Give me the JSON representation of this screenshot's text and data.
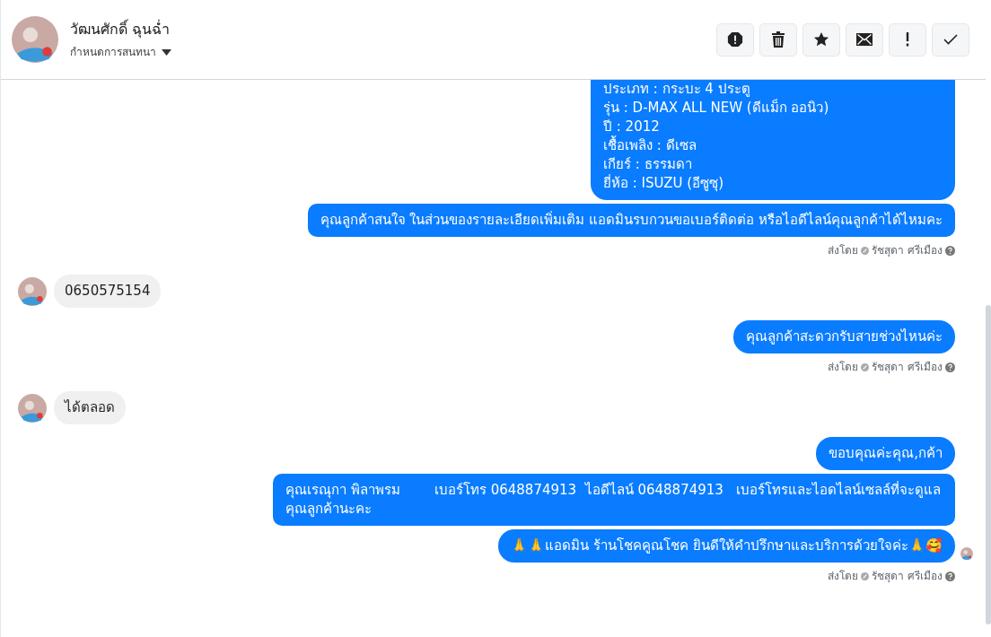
{
  "header": {
    "name": "วัฒนศักดิ์ ฉุนฉ่ำ",
    "subtitle": "กำหนดการสนทนา",
    "actions": [
      {
        "kind": "alert"
      },
      {
        "kind": "trash"
      },
      {
        "kind": "star"
      },
      {
        "kind": "mail"
      },
      {
        "kind": "exclaim"
      },
      {
        "kind": "check"
      }
    ]
  },
  "messages": [
    {
      "kind": "outgoing",
      "seen": false,
      "lines": [
        "ประเภท : กระบะ 4 ประตู",
        "รุ่น : D-MAX ALL NEW (ดีแม็ก ออนิว)",
        "ปี : 2012",
        "เชื้อเพลิง : ดีเซล",
        "เกียร์ : ธรรมดา",
        "ยี่ห้อ : ISUZU (อีซูซุ)"
      ]
    },
    {
      "kind": "outgoing",
      "seen": false,
      "lines": [
        "คุณลูกค้าสนใจ ในส่วนของรายละเอียดเพิ่มเติม แอดมินรบกวนขอเบอร์ติดต่อ หรือไอดีไลน์คุณลูกค้าได้ไหมคะ"
      ]
    },
    {
      "kind": "sent_by",
      "prefix": "ส่งโดย",
      "name": "รัชสุดา ศรีเมือง"
    },
    {
      "kind": "incoming",
      "lines": [
        "0650575154"
      ]
    },
    {
      "kind": "outgoing",
      "seen": false,
      "lines": [
        "คุณลูกค้าสะดวกรับสายช่วงไหนค่ะ"
      ]
    },
    {
      "kind": "sent_by",
      "prefix": "ส่งโดย",
      "name": "รัชสุดา ศรีเมือง"
    },
    {
      "kind": "incoming",
      "lines": [
        "ได้ตลอด"
      ]
    },
    {
      "kind": "outgoing",
      "seen": false,
      "lines": [
        "ขอบคุณค่ะคุณ,กค้า"
      ]
    },
    {
      "kind": "outgoing",
      "seen": false,
      "lines": [
        "คุณเรณุกา พิลาพรม        เบอร์โทร 0648874913  ไอดีไลน์ 0648874913   เบอร์โทรและไอดไลน์เซลล์ที่จะดูแลคุณลูกค้านะคะ"
      ]
    },
    {
      "kind": "outgoing",
      "seen": true,
      "lines": [
        "🙏🙏แอดมิน ร้านโชคคูณโชค ยินดีให้คำปรึกษาและบริการด้วยใจค่ะ🙏🥰"
      ]
    },
    {
      "kind": "sent_by",
      "prefix": "ส่งโดย",
      "name": "รัชสุดา ศรีเมือง"
    }
  ]
}
